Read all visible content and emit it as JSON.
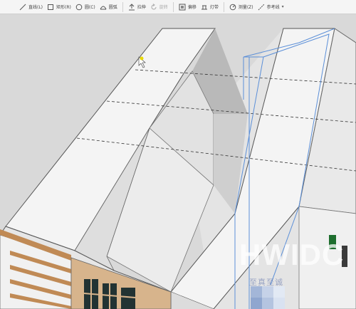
{
  "toolbar": {
    "tools": [
      {
        "label": "直线(L)",
        "icon": "line-icon"
      },
      {
        "label": "矩形(R)",
        "icon": "rectangle-icon"
      },
      {
        "label": "圆(C)",
        "icon": "circle-icon"
      },
      {
        "label": "圆弧",
        "icon": "arc-icon"
      },
      {
        "label": "拉伸",
        "icon": "extrude-icon"
      },
      {
        "label": "旋转",
        "icon": "rotate-icon"
      },
      {
        "label": "偏移",
        "icon": "offset-icon"
      },
      {
        "label": "灯带",
        "icon": "lightstrip-icon"
      },
      {
        "label": "测量(Z)",
        "icon": "measure-icon"
      },
      {
        "label": "参考线",
        "icon": "guide-icon"
      }
    ]
  },
  "watermark": {
    "text": "HWIDC",
    "sub": "至真至诚"
  },
  "colors": {
    "selection": "#5b8fd8",
    "surface": "#f4f4f4",
    "shade": "#c9c9c9",
    "wood": "#c08a55",
    "cursor": "#e8d800"
  }
}
